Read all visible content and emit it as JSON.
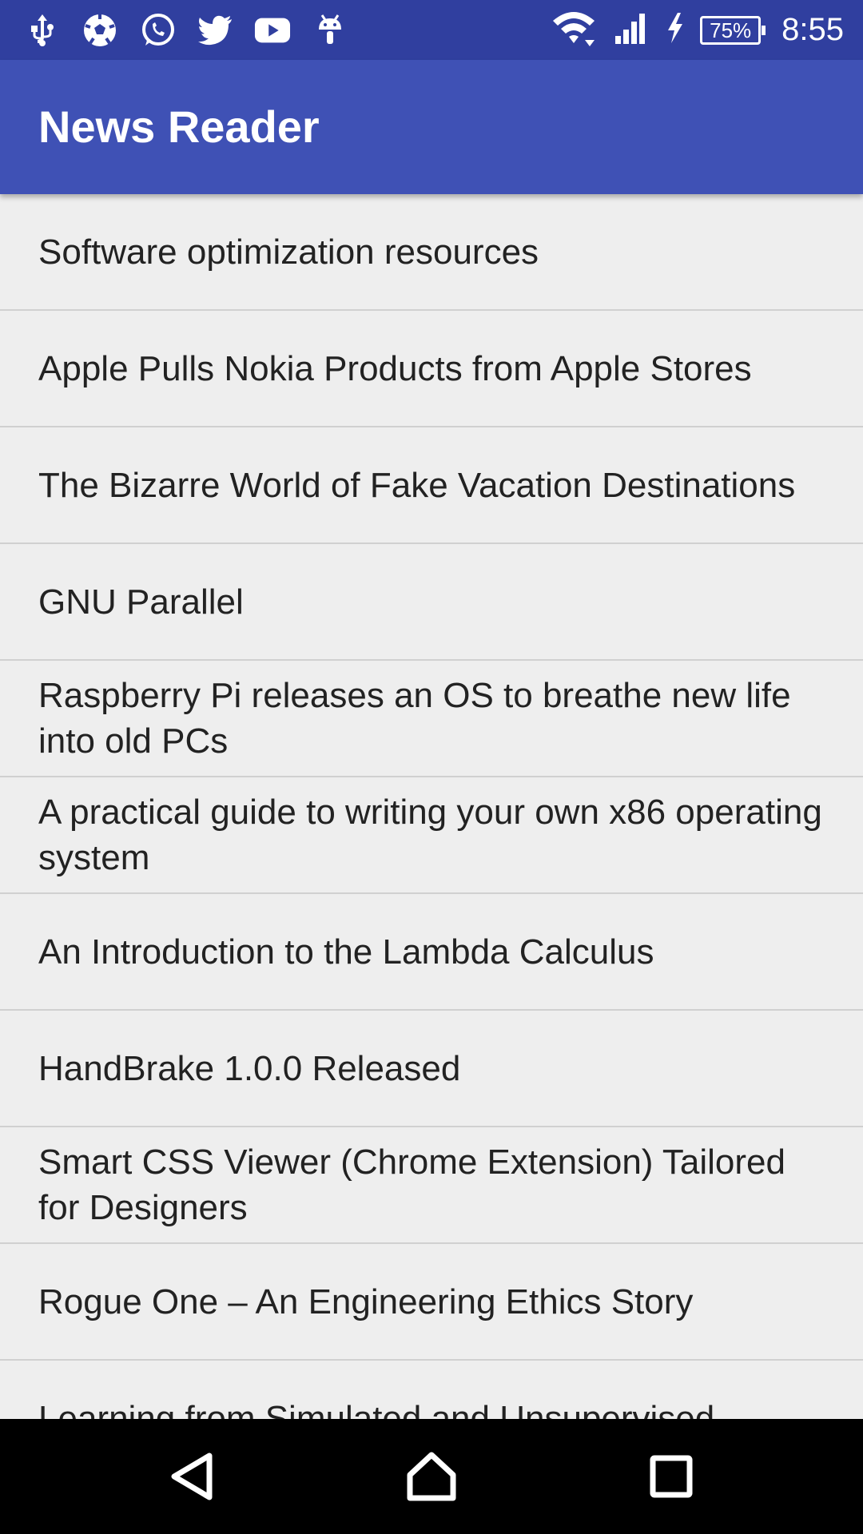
{
  "status_bar": {
    "icons_left": [
      "usb-icon",
      "soccer-ball-icon",
      "whatsapp-icon",
      "twitter-icon",
      "youtube-icon",
      "android-debug-icon"
    ],
    "icons_right": [
      "wifi-icon",
      "cell-signal-icon",
      "charging-icon",
      "battery-icon"
    ],
    "battery_percent": "75%",
    "time": "8:55",
    "color": "#303f9f"
  },
  "app_bar": {
    "title": "News Reader",
    "color": "#3f51b5"
  },
  "news": {
    "items": [
      "Software optimization resources",
      "Apple Pulls Nokia Products from Apple Stores",
      "The Bizarre World of Fake Vacation Destinations",
      "GNU Parallel",
      "Raspberry Pi releases an OS to breathe new life into old PCs",
      "A practical guide to writing your own x86 operating system",
      "An Introduction to the Lambda Calculus",
      "HandBrake 1.0.0 Released",
      "Smart CSS Viewer (Chrome Extension) Tailored for Designers",
      "Rogue One – An Engineering Ethics Story",
      "Learning from Simulated and Unsupervised"
    ]
  },
  "nav_bar": {
    "buttons": [
      "back-icon",
      "home-icon",
      "recents-icon"
    ]
  }
}
